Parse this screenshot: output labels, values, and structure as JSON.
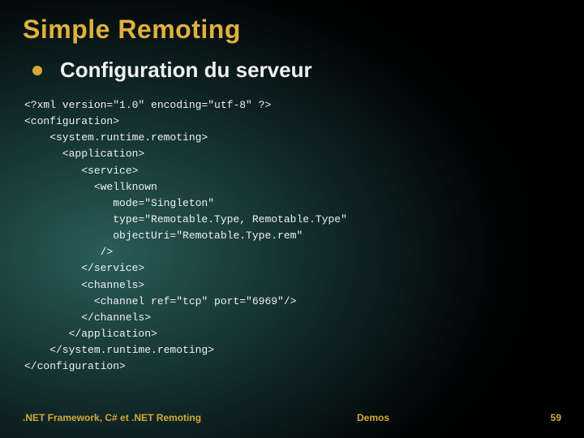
{
  "slide": {
    "title": "Simple Remoting",
    "bullet": "Configuration du serveur",
    "code": "<?xml version=\"1.0\" encoding=\"utf-8\" ?>\n<configuration>\n    <system.runtime.remoting>\n      <application>\n         <service>\n           <wellknown\n              mode=\"Singleton\"\n              type=\"Remotable.Type, Remotable.Type\"\n              objectUri=\"Remotable.Type.rem\"\n            />\n         </service>\n         <channels>\n           <channel ref=\"tcp\" port=\"6969\"/>\n         </channels>\n       </application>\n    </system.runtime.remoting>\n</configuration>"
  },
  "footer": {
    "left": ".NET Framework, C# et .NET Remoting",
    "center": "Demos",
    "right": "59"
  }
}
